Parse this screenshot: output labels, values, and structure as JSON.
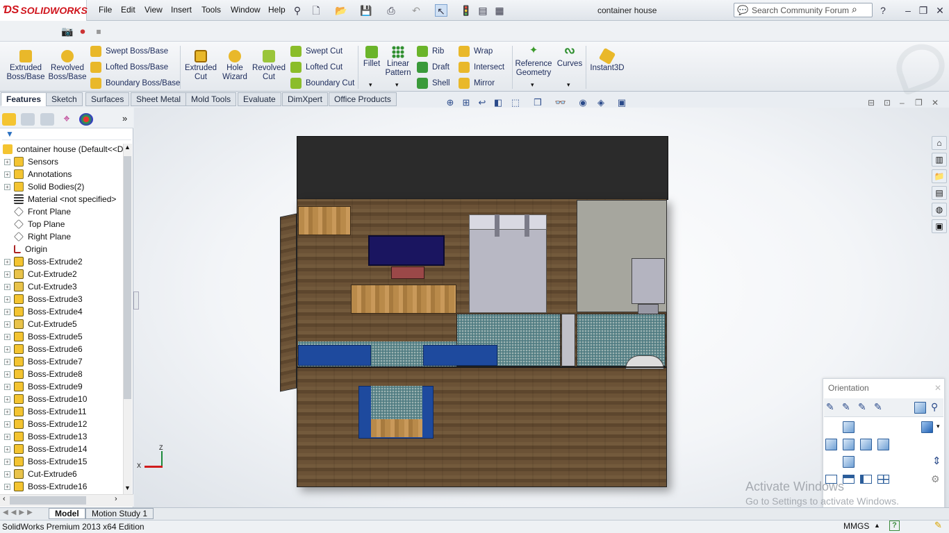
{
  "app": {
    "brand": "SOLIDWORKS",
    "doc_title": "container house"
  },
  "menu": [
    "File",
    "Edit",
    "View",
    "Insert",
    "Tools",
    "Window",
    "Help"
  ],
  "search": {
    "placeholder": "Search Community Forum"
  },
  "commands": {
    "extruded_boss": "Extruded Boss/Base",
    "revolved_boss": "Revolved Boss/Base",
    "swept_boss": "Swept Boss/Base",
    "lofted_boss": "Lofted Boss/Base",
    "boundary_boss": "Boundary Boss/Base",
    "extruded_cut": "Extruded Cut",
    "hole_wizard": "Hole Wizard",
    "revolved_cut": "Revolved Cut",
    "swept_cut": "Swept Cut",
    "lofted_cut": "Lofted Cut",
    "boundary_cut": "Boundary Cut",
    "fillet": "Fillet",
    "linear_pattern": "Linear Pattern",
    "rib": "Rib",
    "draft": "Draft",
    "shell": "Shell",
    "wrap": "Wrap",
    "intersect": "Intersect",
    "mirror": "Mirror",
    "reference_geometry": "Reference Geometry",
    "curves": "Curves",
    "instant3d": "Instant3D"
  },
  "tabs": [
    "Features",
    "Sketch",
    "Surfaces",
    "Sheet Metal",
    "Mold Tools",
    "Evaluate",
    "DimXpert",
    "Office Products"
  ],
  "tree": {
    "root": "container house  (Default<<D",
    "items": [
      "Sensors",
      "Annotations",
      "Solid Bodies(2)",
      "Material <not specified>",
      "Front Plane",
      "Top Plane",
      "Right Plane",
      "Origin",
      "Boss-Extrude2",
      "Cut-Extrude2",
      "Cut-Extrude3",
      "Boss-Extrude3",
      "Boss-Extrude4",
      "Cut-Extrude5",
      "Boss-Extrude5",
      "Boss-Extrude6",
      "Boss-Extrude7",
      "Boss-Extrude8",
      "Boss-Extrude9",
      "Boss-Extrude10",
      "Boss-Extrude11",
      "Boss-Extrude12",
      "Boss-Extrude13",
      "Boss-Extrude14",
      "Boss-Extrude15",
      "Cut-Extrude6",
      "Boss-Extrude16"
    ]
  },
  "triad": {
    "x": "X",
    "z": "Z"
  },
  "orientation": {
    "title": "Orientation"
  },
  "watermark": {
    "line1": "Activate Windows",
    "line2": "Go to Settings to activate Windows."
  },
  "bottom_tabs": [
    "Model",
    "Motion Study 1"
  ],
  "status": {
    "edition": "SolidWorks Premium 2013 x64 Edition",
    "units": "MMGS"
  }
}
